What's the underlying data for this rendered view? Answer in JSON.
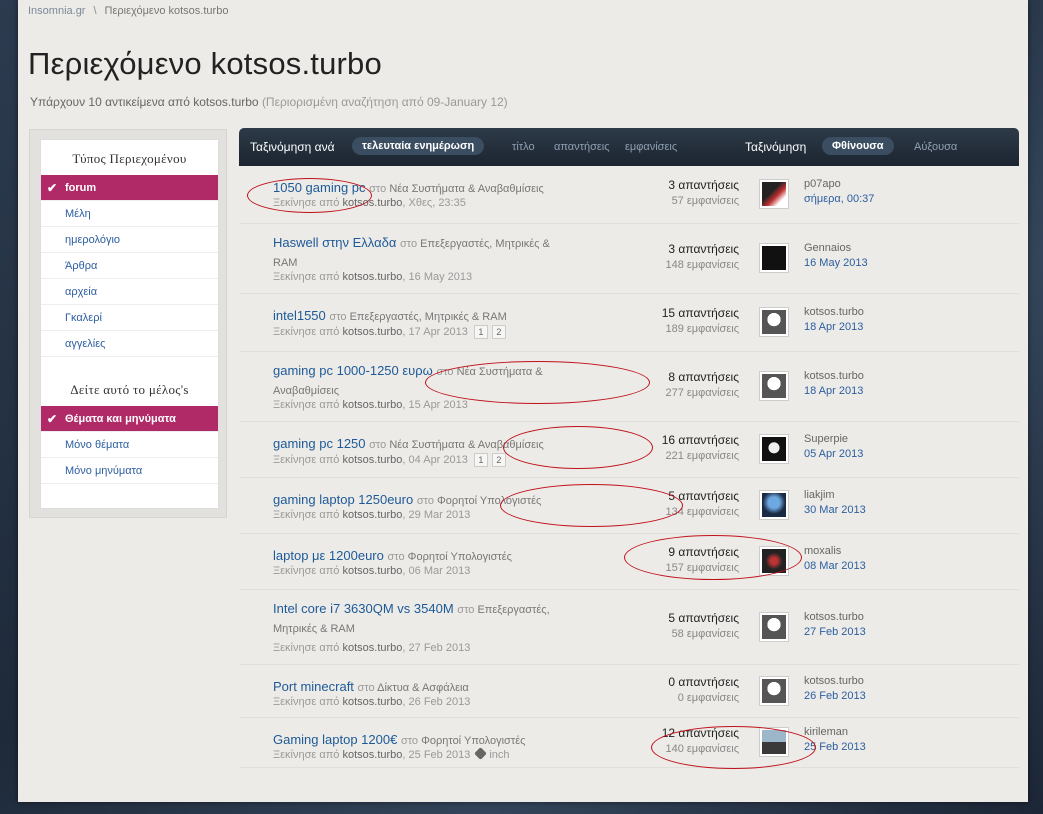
{
  "breadcrumb": {
    "home": "Insomnia.gr",
    "separator": "\\",
    "current": "Περιεχόμενο kotsos.turbo"
  },
  "title": "Περιεχόμενο kotsos.turbo",
  "subtitle": {
    "main": "Υπάρχουν 10 αντικείμενα από kotsos.turbo",
    "note": "(Περιορισμένη αναζήτηση από 09-January 12)"
  },
  "sidebar": {
    "section1": "Τύπος Περιεχομένου",
    "items1": [
      "forum",
      "Μέλη",
      "ημερολόγιο",
      "Άρθρα",
      "αρχεία",
      "Γκαλερί",
      "αγγελίες"
    ],
    "section2": "Δείτε αυτό το μέλος's",
    "items2": [
      "Θέματα και μηνύματα",
      "Μόνο θέματα",
      "Μόνο μηνύματα"
    ]
  },
  "sortbar": {
    "sort_by": "Ταξινόμηση ανά",
    "active": "τελευταία ενημέρωση",
    "options": [
      "τίτλο",
      "απαντήσεις",
      "εμφανίσεις"
    ],
    "order_label": "Ταξινόμηση",
    "order_active": "Φθίνουσα",
    "order_other": "Αύξουσα"
  },
  "labels": {
    "in": "στο",
    "started_by": "Ξεκίνησε από",
    "replies": "απαντήσεις",
    "views": "εμφανίσεις"
  },
  "topics": [
    {
      "title": "1050 gaming pc",
      "forum": "Νέα Συστήματα & Αναβαθμίσεις",
      "author": "kotsos.turbo",
      "date": "Χθες, 23:35",
      "replies": "3",
      "views": "57",
      "last_user": "p07apo",
      "last_date": "σήμερα, 00:37"
    },
    {
      "title": "Haswell στην Ελλαδα",
      "forum": "Επεξεργαστές, Μητρικές &",
      "forum2": "RAM",
      "author": "kotsos.turbo",
      "date": "16 May 2013",
      "replies": "3",
      "views": "148",
      "last_user": "Gennaios",
      "last_date": "16 May 2013"
    },
    {
      "title": "intel1550",
      "forum": "Επεξεργαστές, Μητρικές & RAM",
      "author": "kotsos.turbo",
      "date": "17 Apr 2013",
      "pages": [
        "1",
        "2"
      ],
      "replies": "15",
      "views": "189",
      "last_user": "kotsos.turbo",
      "last_date": "18 Apr 2013"
    },
    {
      "title": "gaming pc 1000-1250 ευρω",
      "forum": "Νέα Συστήματα &",
      "forum2": "Αναβαθμίσεις",
      "author": "kotsos.turbo",
      "date": "15 Apr 2013",
      "replies": "8",
      "views": "277",
      "last_user": "kotsos.turbo",
      "last_date": "18 Apr 2013"
    },
    {
      "title": "gaming pc 1250",
      "forum": "Νέα Συστήματα & Αναβαθμίσεις",
      "author": "kotsos.turbo",
      "date": "04 Apr 2013",
      "pages": [
        "1",
        "2"
      ],
      "replies": "16",
      "views": "221",
      "last_user": "Superpie",
      "last_date": "05 Apr 2013"
    },
    {
      "title": "gaming laptop 1250euro",
      "forum": "Φορητοί Υπολογιστές",
      "author": "kotsos.turbo",
      "date": "29 Mar 2013",
      "replies": "5",
      "views": "134",
      "last_user": "liakjim",
      "last_date": "30 Mar 2013"
    },
    {
      "title": "laptop με 1200euro",
      "forum": "Φορητοί Υπολογιστές",
      "author": "kotsos.turbo",
      "date": "06 Mar 2013",
      "replies": "9",
      "views": "157",
      "last_user": "moxalis",
      "last_date": "08 Mar 2013"
    },
    {
      "title": "Intel core i7 3630QM vs 3540M",
      "forum": "Επεξεργαστές,",
      "forum2": "Μητρικές & RAM",
      "author": "kotsos.turbo",
      "date": "27 Feb 2013",
      "replies": "5",
      "views": "58",
      "last_user": "kotsos.turbo",
      "last_date": "27 Feb 2013"
    },
    {
      "title": "Port minecraft",
      "forum": "Δίκτυα & Ασφάλεια",
      "author": "kotsos.turbo",
      "date": "26 Feb 2013",
      "replies": "0",
      "views": "0",
      "last_user": "kotsos.turbo",
      "last_date": "26 Feb 2013"
    },
    {
      "title": "Gaming laptop 1200€",
      "forum": "Φορητοί Υπολογιστές",
      "author": "kotsos.turbo",
      "date": "25 Feb 2013",
      "tag": "inch",
      "replies": "12",
      "views": "140",
      "last_user": "kirileman",
      "last_date": "25 Feb 2013"
    }
  ],
  "colors": {
    "accent": "#b02a68",
    "link": "#1e5a99",
    "annotation": "#c0101a"
  }
}
